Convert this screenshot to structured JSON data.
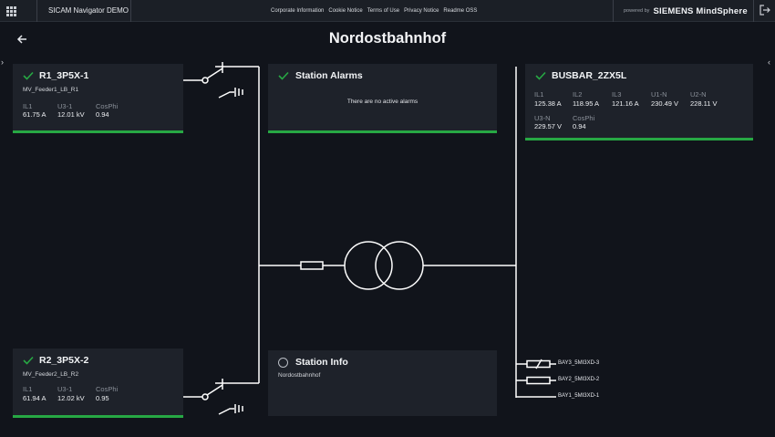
{
  "topbar": {
    "app_title": "SICAM Navigator DEMO",
    "links": [
      "Corporate Information",
      "Cookie Notice",
      "Terms of Use",
      "Privacy Notice",
      "Readme OSS"
    ],
    "powered_by": "powered by",
    "brand": "SIEMENS MindSphere"
  },
  "page": {
    "title": "Nordostbahnhof"
  },
  "feeder1": {
    "name": "R1_3P5X-1",
    "subtitle": "MV_Feeder1_LB_R1",
    "status": "ok",
    "measurements": [
      {
        "label": "IL1",
        "value": "61.75 A"
      },
      {
        "label": "U3-1",
        "value": "12.01 kV"
      },
      {
        "label": "CosPhi",
        "value": "0.94"
      }
    ]
  },
  "feeder2": {
    "name": "R2_3P5X-2",
    "subtitle": "MV_Feeder2_LB_R2",
    "status": "ok",
    "measurements": [
      {
        "label": "IL1",
        "value": "61.94 A"
      },
      {
        "label": "U3-1",
        "value": "12.02 kV"
      },
      {
        "label": "CosPhi",
        "value": "0.95"
      }
    ]
  },
  "alarms": {
    "title": "Station Alarms",
    "message": "There are no active alarms",
    "status": "ok"
  },
  "info": {
    "title": "Station Info",
    "text": "Nordostbahnhof"
  },
  "busbar": {
    "name": "BUSBAR_2ZX5L",
    "status": "ok",
    "measurements": [
      {
        "label": "IL1",
        "value": "125.38 A"
      },
      {
        "label": "IL2",
        "value": "118.95 A"
      },
      {
        "label": "IL3",
        "value": "121.16 A"
      },
      {
        "label": "U1-N",
        "value": "230.49 V"
      },
      {
        "label": "U2-N",
        "value": "228.11 V"
      },
      {
        "label": "U3-N",
        "value": "229.57 V"
      },
      {
        "label": "CosPhi",
        "value": "0.94"
      }
    ]
  },
  "bays": [
    "BAY3_5MI3XD-3",
    "BAY2_5MI3XD-2",
    "BAY1_5MI3XD-1"
  ],
  "colors": {
    "background": "#11141b",
    "panel": "#1e222a",
    "status_ok": "#27a844",
    "line": "#ffffff"
  },
  "icons": [
    "apps-grid-icon",
    "logout-icon",
    "arrow-left-icon",
    "chevron-right-icon",
    "chevron-left-icon",
    "checkmark-icon",
    "circle-status-icon"
  ]
}
